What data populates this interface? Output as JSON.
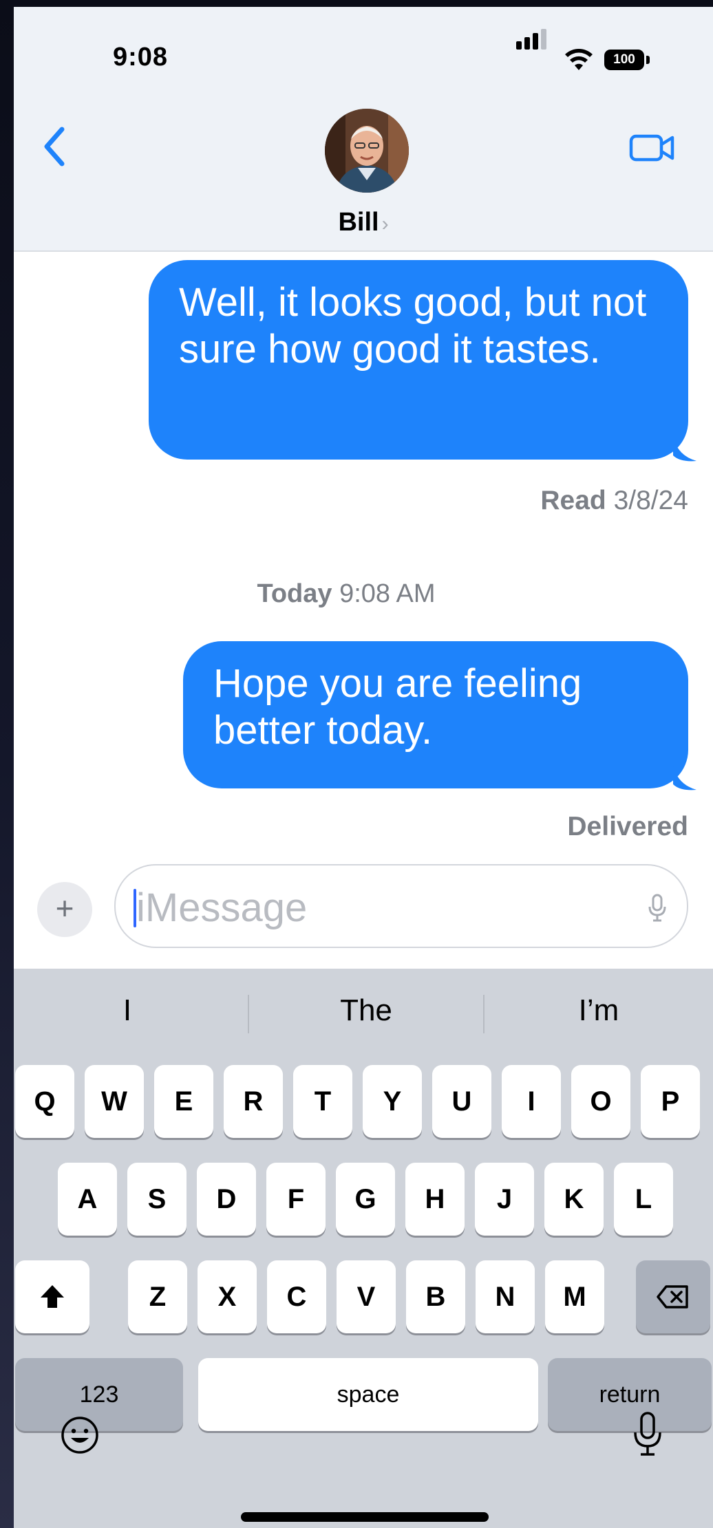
{
  "status_bar": {
    "time": "9:08",
    "battery": "100"
  },
  "header": {
    "contact_name": "Bill",
    "contact_chevron": "›"
  },
  "messages": [
    {
      "text": "Well, it looks good, but not sure how good it tastes.",
      "receipt_label": "Read",
      "receipt_date": "3/8/24"
    },
    {
      "timestamp_day": "Today",
      "timestamp_time": "9:08 AM",
      "text": "Hope you are feeling better today.",
      "receipt": "Delivered"
    }
  ],
  "compose": {
    "plus": "+",
    "placeholder": "iMessage"
  },
  "keyboard": {
    "suggestions": [
      "I",
      "The",
      "I’m"
    ],
    "row1": [
      "Q",
      "W",
      "E",
      "R",
      "T",
      "Y",
      "U",
      "I",
      "O",
      "P"
    ],
    "row2": [
      "A",
      "S",
      "D",
      "F",
      "G",
      "H",
      "J",
      "K",
      "L"
    ],
    "row3": [
      "Z",
      "X",
      "C",
      "V",
      "B",
      "N",
      "M"
    ],
    "numbers_label": "123",
    "space_label": "space",
    "return_label": "return"
  },
  "icons": {
    "back": "chevron-left-icon",
    "video": "video-camera-icon",
    "mic": "microphone-icon",
    "emoji": "emoji-icon",
    "shift": "shift-icon",
    "delete": "delete-icon"
  },
  "colors": {
    "accent": "#1e83fb",
    "header_bg": "#eef2f7",
    "keyboard_bg": "#cfd3da",
    "key_dark": "#aab0bb"
  }
}
